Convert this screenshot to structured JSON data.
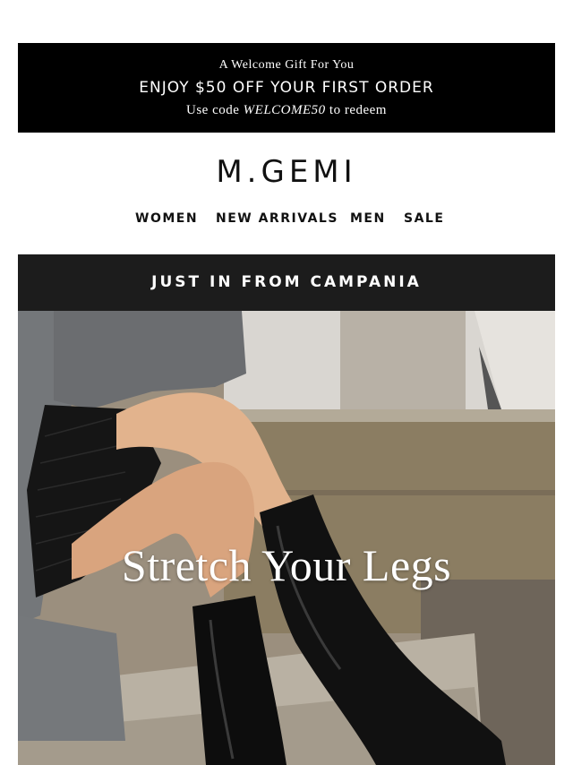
{
  "promo": {
    "kicker": "A Welcome Gift For You",
    "headline": "ENJOY $50 OFF YOUR FIRST ORDER",
    "code_prefix": "Use code",
    "code": "WELCOME50",
    "code_suffix": "to redeem"
  },
  "brand": {
    "logo": "M.GEMI"
  },
  "nav": {
    "items": [
      {
        "label": "WOMEN"
      },
      {
        "label": "NEW ARRIVALS"
      },
      {
        "label": "MEN"
      },
      {
        "label": "SALE"
      }
    ]
  },
  "band": {
    "label": "JUST IN FROM CAMPANIA"
  },
  "hero": {
    "tagline": "Stretch Your Legs"
  },
  "colors": {
    "promo_bg": "#000000",
    "band_bg": "#1c1c1c",
    "text": "#111111"
  }
}
